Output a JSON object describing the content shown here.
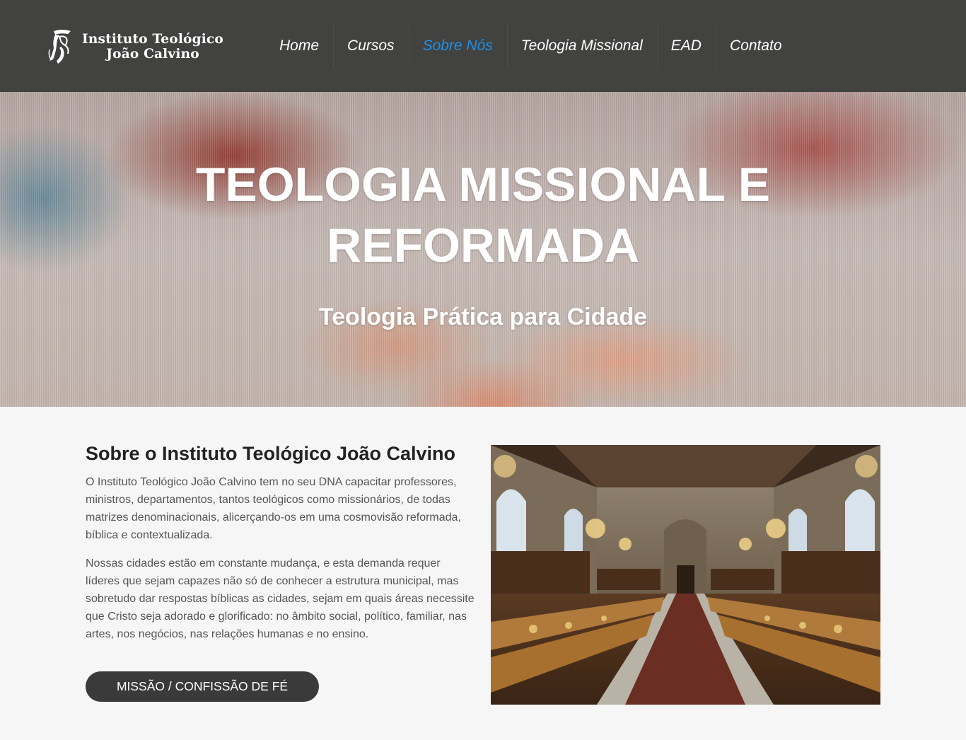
{
  "header": {
    "logo": {
      "line1": "Instituto Teológico",
      "line2": "João Calvino",
      "icon": "calvin-portrait-icon"
    },
    "nav": {
      "items": [
        {
          "label": "Home"
        },
        {
          "label": "Cursos"
        },
        {
          "label": "Sobre Nós"
        },
        {
          "label": "Teologia Missional"
        },
        {
          "label": "EAD"
        },
        {
          "label": "Contato"
        }
      ],
      "active_index": 2
    }
  },
  "hero": {
    "title_line1": "TEOLOGIA MISSIONAL E",
    "title_line2": "REFORMADA",
    "subtitle": "Teologia Prática para Cidade"
  },
  "about": {
    "heading": "Sobre o Instituto Teológico João Calvino",
    "paragraph1": "O Instituto Teológico João Calvino tem no seu DNA capacitar professores, ministros, departamentos, tantos teológicos como missionários, de todas matrizes denominacionais, alicerçando-os em uma cosmovisão reformada, bíblica e contextualizada.",
    "paragraph2": "Nossas cidades estão em constante mudança, e esta demanda requer líderes que sejam capazes não só de conhecer a estrutura municipal, mas sobretudo dar respostas bíblicas as cidades, sejam em quais áreas necessite que Cristo seja adorado e glorificado: no âmbito social, político, familiar, nas artes, nos negócios, nas relações humanas e no ensino.",
    "button_label": "MISSÃO / CONFISSÃO DE FÉ",
    "image": "library-reading-room-photo"
  },
  "colors": {
    "header_bg": "#424241",
    "nav_active": "#1e90e8",
    "button_bg": "#3a3a3a",
    "page_bg": "#f6f6f6"
  }
}
